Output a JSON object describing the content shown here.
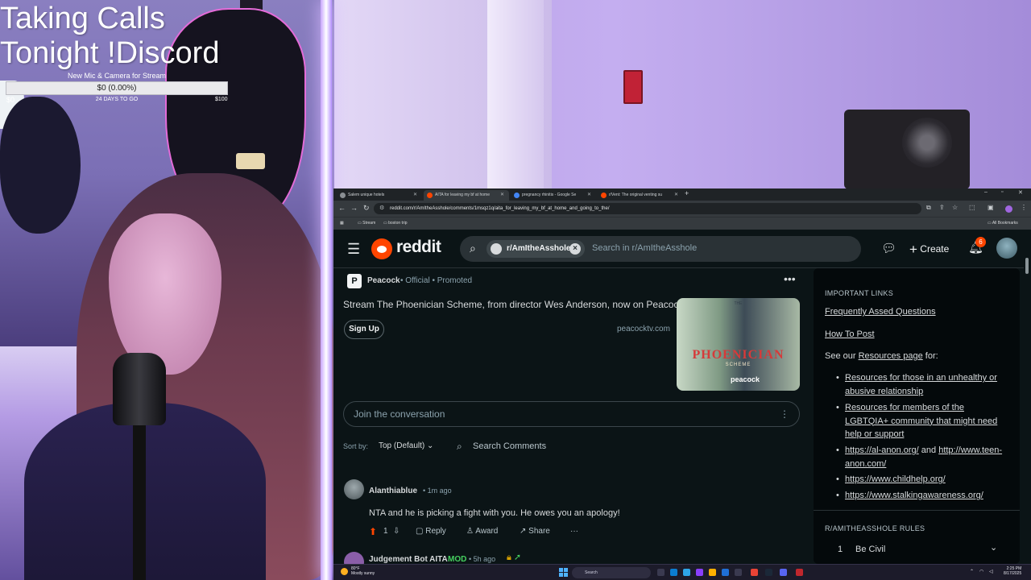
{
  "overlay": {
    "title_line1": "Taking Calls",
    "title_line2": "Tonight !Discord",
    "goal_label": "New Mic & Camera for Stream",
    "progress_text": "$0 (0.00%)",
    "progress_fraction": 0.0,
    "min_label": "$0",
    "days_left": "24 DAYS TO GO",
    "max_label": "$100"
  },
  "browser": {
    "tabs": [
      {
        "label": "Salem unique hotels",
        "color": "#8a8f93",
        "active": false
      },
      {
        "label": "AITA for leaving my bf at home",
        "color": "#ff4500",
        "active": true
      },
      {
        "label": "pregnancy rhinitis - Google Se",
        "color": "#4285f4",
        "active": false
      },
      {
        "label": "r/Vent: The original venting su",
        "color": "#ff4500",
        "active": false
      }
    ],
    "new_tab": "+",
    "url": "reddit.com/r/AmItheAsshole/comments/1msqz1q/aita_for_leaving_my_bf_at_home_and_going_to_the/",
    "bookmarks": [
      "Stream",
      "boston trip"
    ],
    "all_bookmarks": "All Bookmarks"
  },
  "reddit": {
    "wordmark": "reddit",
    "subreddit_chip": "r/AmItheAsshole",
    "search_placeholder": "Search in r/AmItheAsshole",
    "create_label": "Create",
    "notification_count": "6"
  },
  "ad": {
    "logo_letter": "P",
    "brand": "Peacock",
    "meta": "• Official • Promoted",
    "text": "Stream The Phoenician Scheme, from director Wes Anderson, now on Peacock.",
    "signup_label": "Sign Up",
    "domain": "peacocktv.com",
    "poster_title": "PHOENICIAN",
    "poster_sub": "SCHEME",
    "poster_brand": "peacock",
    "poster_top": "THE"
  },
  "comments": {
    "join_placeholder": "Join the conversation",
    "sort_label": "Sort by:",
    "sort_value": "Top (Default) ⌄",
    "search_label": "Search Comments",
    "items": [
      {
        "user": "Alanthiablue",
        "time": "• 1m ago",
        "body": "NTA and he is picking a fight with you. He owes you an apology!",
        "score": "1",
        "reply": "Reply",
        "award": "Award",
        "share": "Share",
        "more": "···"
      },
      {
        "user": "Judgement Bot AITA",
        "mod": "MOD",
        "time": "• 5h ago"
      }
    ]
  },
  "sidebar": {
    "important_heading": "IMPORTANT LINKS",
    "faq": "Frequently Assed Questions",
    "howto": "How To Post",
    "see_prefix": "See our",
    "resources_link": "Resources page",
    "see_suffix": "for:",
    "bullets": [
      {
        "link": "Resources for those in an unhealthy or abusive relationship"
      },
      {
        "link": "Resources for members of the LGBTQIA+ community that might need help or support"
      },
      {
        "link": "https://al-anon.org/",
        "mid": " and ",
        "link2": "http://www.teen-anon.com/"
      },
      {
        "link": "https://www.childhelp.org/"
      },
      {
        "link": "https://www.stalkingawareness.org/"
      }
    ],
    "rules_heading": "R/AMITHEASSHOLE RULES",
    "rule1_num": "1",
    "rule1": "Be Civil"
  },
  "taskbar": {
    "temp": "80°F",
    "weather": "Mostly sunny",
    "search": "Search",
    "time": "2:25 PM",
    "date": "8/17/2025"
  }
}
